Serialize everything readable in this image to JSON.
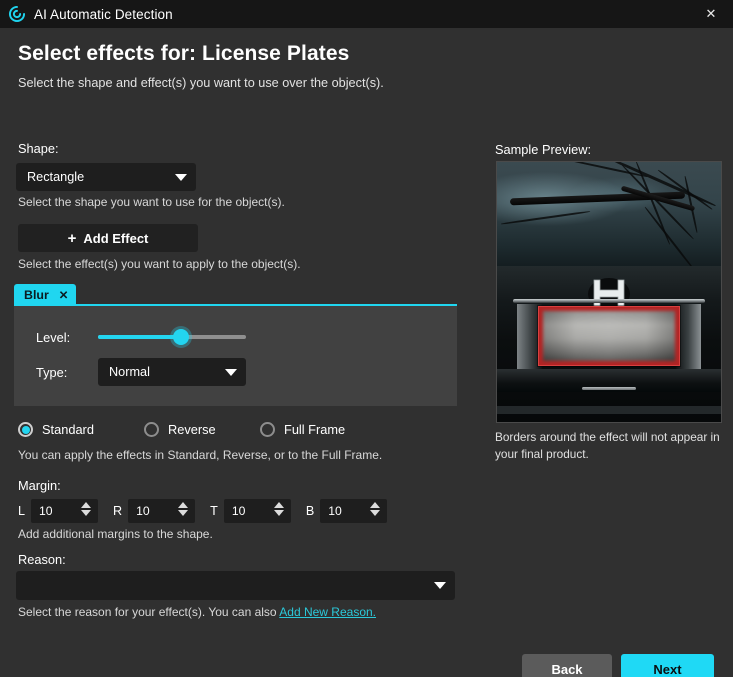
{
  "titlebar": {
    "app_title": "AI Automatic Detection",
    "logo_icon": "spiral-logo-icon",
    "close_icon": "close-icon",
    "close_glyph": "✕",
    "accent": "#20d6f0"
  },
  "header": {
    "heading": "Select effects for: License Plates",
    "subtitle": "Select the shape and effect(s) you want to use over the object(s)."
  },
  "shape": {
    "label": "Shape:",
    "selected": "Rectangle",
    "hint": "Select the shape you want to use for the object(s)."
  },
  "add_effect": {
    "plus": "+",
    "label": "Add Effect",
    "hint": "Select the effect(s) you want to apply to the object(s)."
  },
  "effect_tabs": [
    {
      "label": "Blur",
      "close_glyph": "✕",
      "active": true
    }
  ],
  "effect_settings": {
    "level_label": "Level:",
    "level_value": 56,
    "level_min": 0,
    "level_max": 100,
    "type_label": "Type:",
    "type_selected": "Normal"
  },
  "apply_modes": {
    "options": [
      {
        "label": "Standard",
        "checked": true
      },
      {
        "label": "Reverse",
        "checked": false
      },
      {
        "label": "Full Frame",
        "checked": false
      }
    ],
    "hint": "You can apply the effects in Standard, Reverse, or to the Full Frame."
  },
  "margin": {
    "label": "Margin:",
    "fields": [
      {
        "letter": "L",
        "value": "10"
      },
      {
        "letter": "R",
        "value": "10"
      },
      {
        "letter": "T",
        "value": "10"
      },
      {
        "letter": "B",
        "value": "10"
      }
    ],
    "hint": "Add additional margins to the shape."
  },
  "reason": {
    "label": "Reason:",
    "selected": "",
    "hint_prefix": "Select the reason for your effect(s). You can also ",
    "link_text": "Add New Reason."
  },
  "preview": {
    "label": "Sample Preview:",
    "note": "Borders around the effect will not appear in your final product.",
    "border_color": "#b32424",
    "image_description": "rear-of-honda-car-with-blurred-license-plate"
  },
  "footer": {
    "back_label": "Back",
    "next_label": "Next"
  }
}
